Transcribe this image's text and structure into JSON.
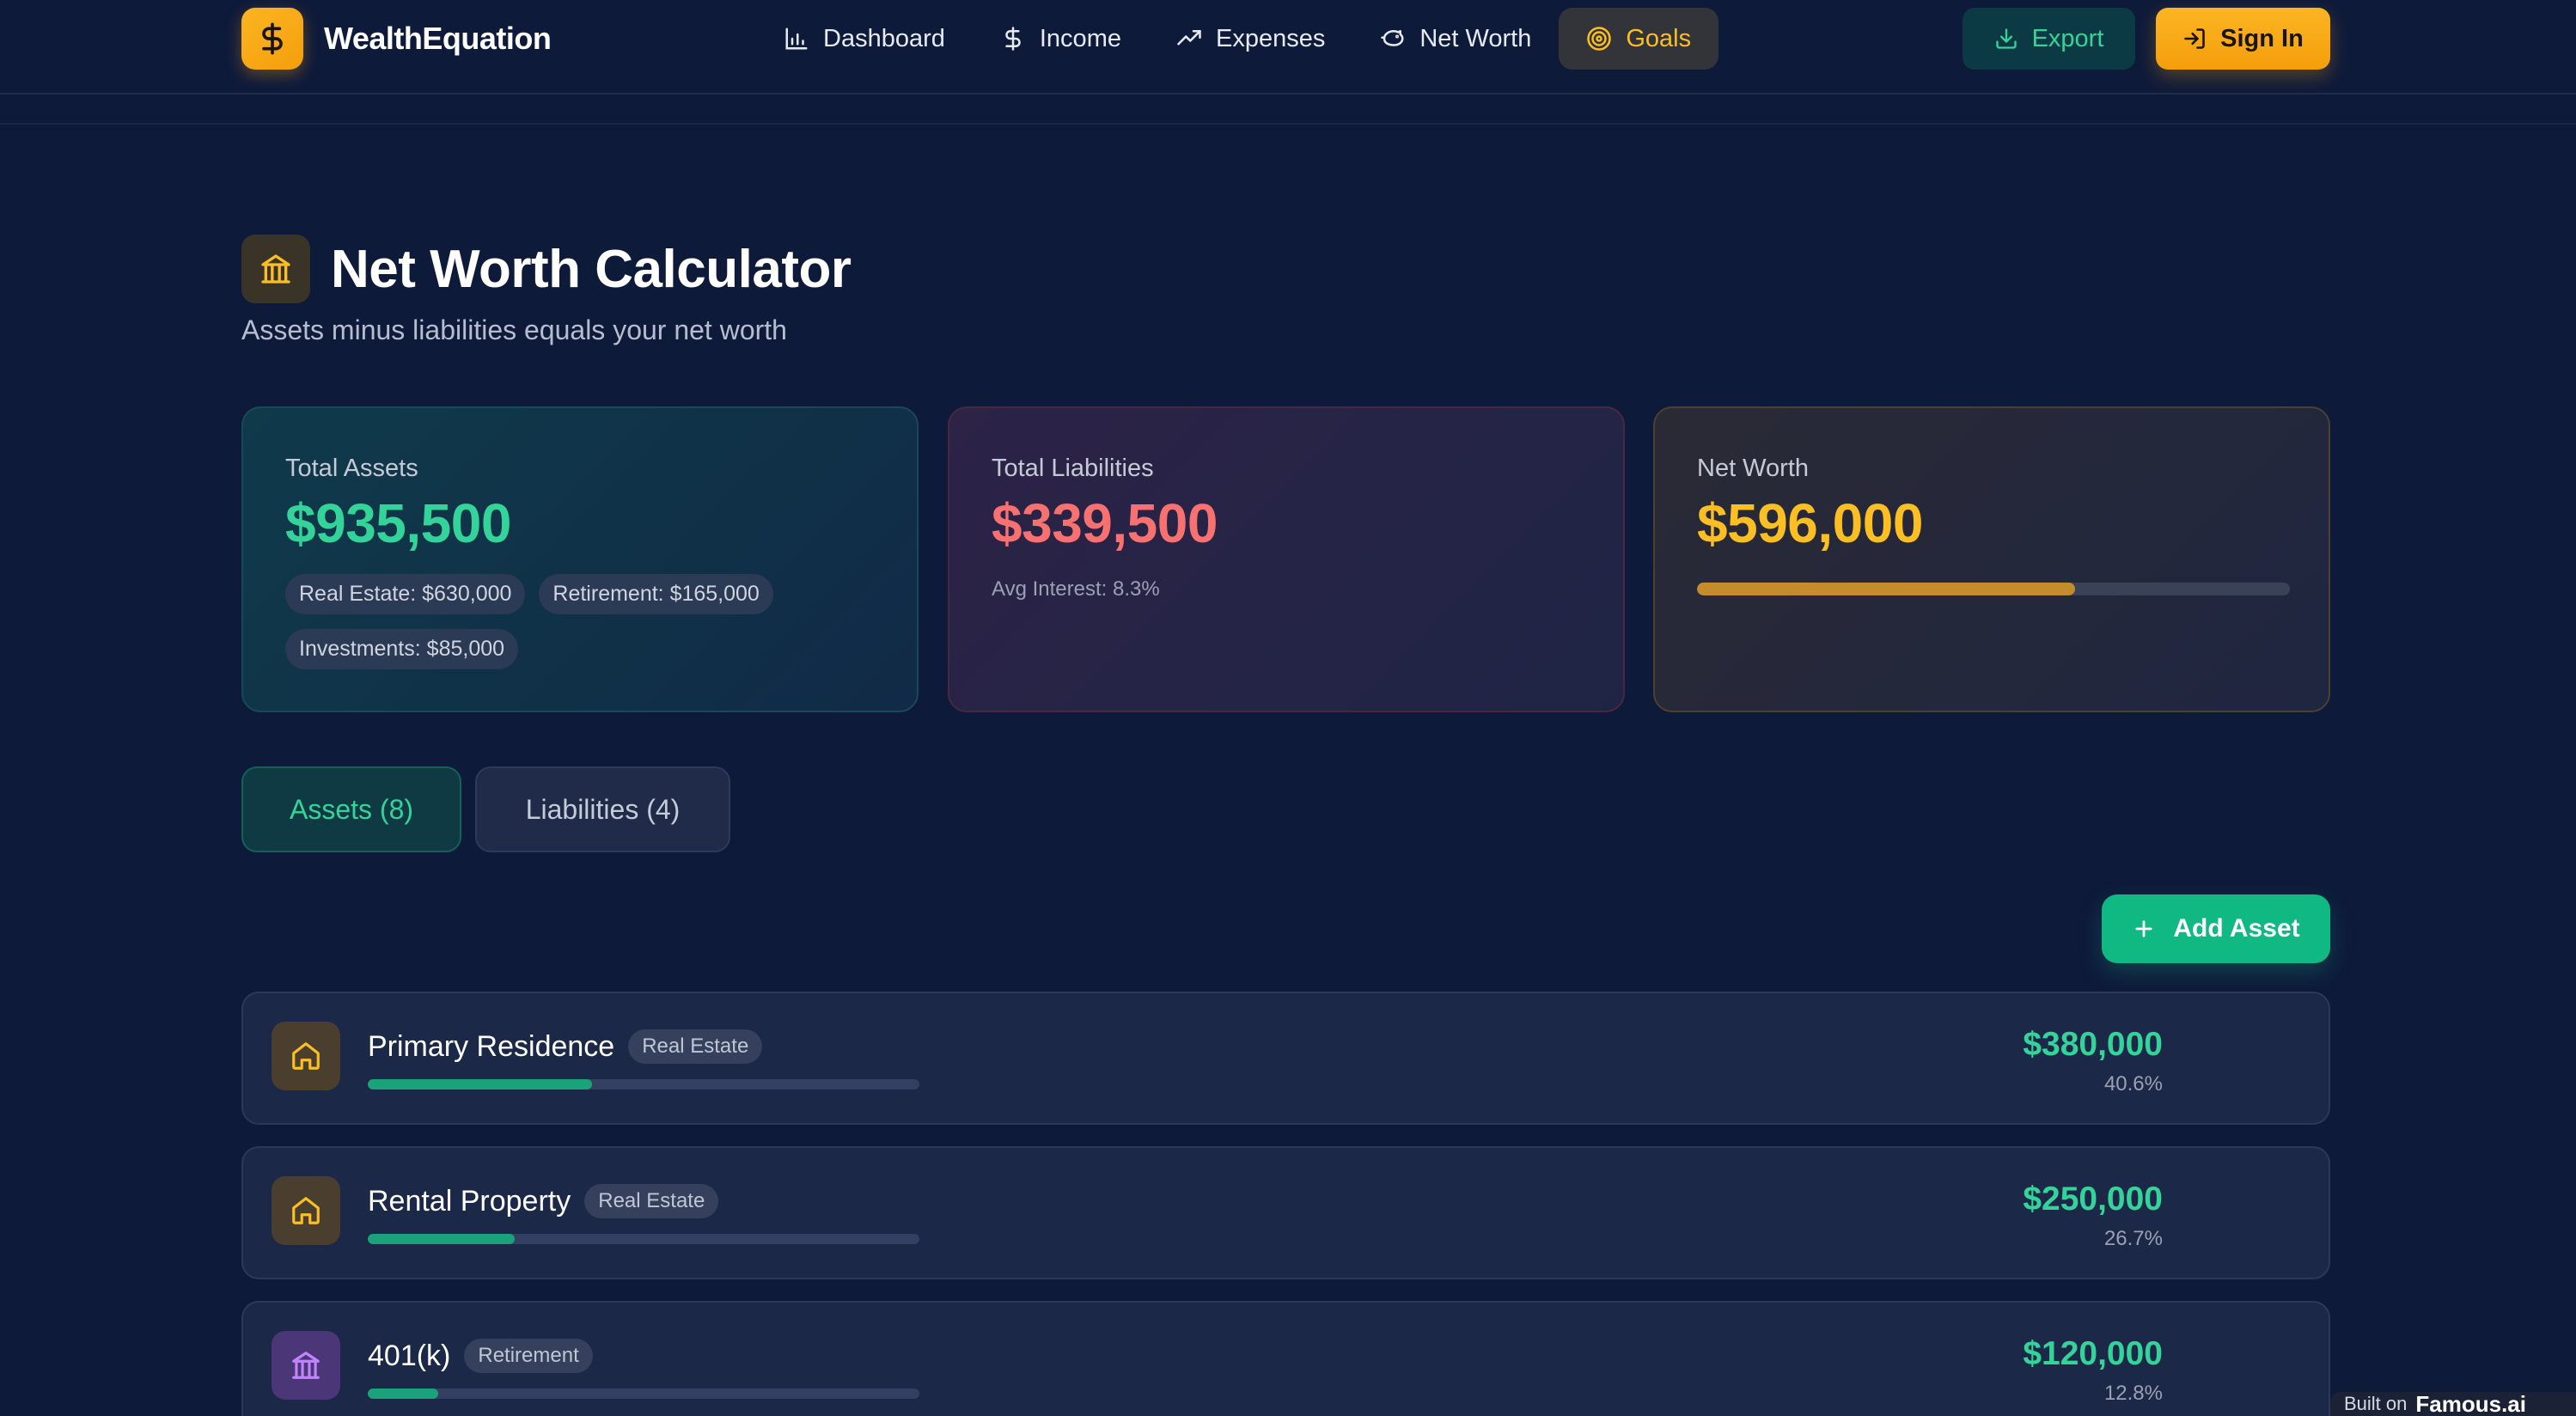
{
  "header": {
    "brand": "WealthEquation",
    "nav": [
      {
        "label": "Dashboard"
      },
      {
        "label": "Income"
      },
      {
        "label": "Expenses"
      },
      {
        "label": "Net Worth"
      },
      {
        "label": "Goals"
      }
    ],
    "export_label": "Export",
    "signin_label": "Sign In"
  },
  "page": {
    "title": "Net Worth Calculator",
    "subtitle": "Assets minus liabilities equals your net worth"
  },
  "summary": {
    "assets": {
      "label": "Total Assets",
      "value": "$935,500",
      "chips": [
        "Real Estate: $630,000",
        "Retirement: $165,000",
        "Investments: $85,000"
      ]
    },
    "liabilities": {
      "label": "Total Liabilities",
      "value": "$339,500",
      "note": "Avg Interest: 8.3%"
    },
    "net": {
      "label": "Net Worth",
      "value": "$596,000",
      "progress_fraction": 0.637
    }
  },
  "tabs": {
    "assets": "Assets (8)",
    "liabilities": "Liabilities (4)"
  },
  "add_label": "Add Asset",
  "rows": [
    {
      "name": "Primary Residence",
      "category": "Real Estate",
      "amount": "$380,000",
      "pct": "40.6%",
      "fraction": 0.406
    },
    {
      "name": "Rental Property",
      "category": "Real Estate",
      "amount": "$250,000",
      "pct": "26.7%",
      "fraction": 0.267
    },
    {
      "name": "401(k)",
      "category": "Retirement",
      "amount": "$120,000",
      "pct": "12.8%",
      "fraction": 0.128
    }
  ],
  "footer": {
    "built_prefix": "Built on",
    "built_brand": "Famous.ai"
  },
  "colors": {
    "background": "#0e1a3a",
    "accent_gold": "#f59e0b",
    "accent_green": "#34d399",
    "accent_red": "#f87171"
  }
}
